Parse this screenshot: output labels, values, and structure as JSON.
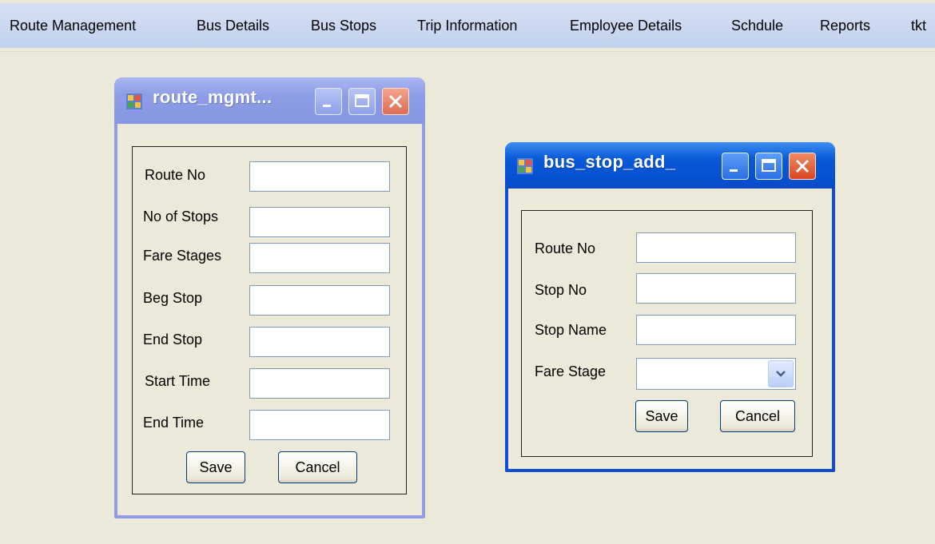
{
  "menu": {
    "items": [
      {
        "label": "Route Management"
      },
      {
        "label": "Bus Details"
      },
      {
        "label": "Bus Stops"
      },
      {
        "label": "Trip Information"
      },
      {
        "label": "Employee Details"
      },
      {
        "label": "Schdule"
      },
      {
        "label": "Reports"
      },
      {
        "label": "tkt"
      }
    ]
  },
  "route_window": {
    "title": "route_mgmt...",
    "title_icon": "form-app-icon",
    "labels": {
      "route_no": "Route No",
      "no_of_stops": "No of Stops",
      "fare_stages": "Fare Stages",
      "beg_stop": "Beg Stop",
      "end_stop": "End Stop",
      "start_time": "Start Time",
      "end_time": "End Time"
    },
    "values": {
      "route_no": "",
      "no_of_stops": "",
      "fare_stages": "",
      "beg_stop": "",
      "end_stop": "",
      "start_time": "",
      "end_time": ""
    },
    "save_label": "Save",
    "cancel_label": "Cancel",
    "active": false
  },
  "bus_stop_window": {
    "title": "bus_stop_add_",
    "title_icon": "form-app-icon",
    "labels": {
      "route_no": "Route No",
      "stop_no": "Stop No",
      "stop_name": "Stop Name",
      "fare_stage": "Fare Stage"
    },
    "values": {
      "route_no": "",
      "stop_no": "",
      "stop_name": "",
      "fare_stage": ""
    },
    "save_label": "Save",
    "cancel_label": "Cancel",
    "active": true
  },
  "colors": {
    "inactive_title": "#8f9ee4",
    "active_title": "#0a5ad8",
    "close_button": "#e15a35",
    "desktop_bg": "#ece9d8"
  }
}
